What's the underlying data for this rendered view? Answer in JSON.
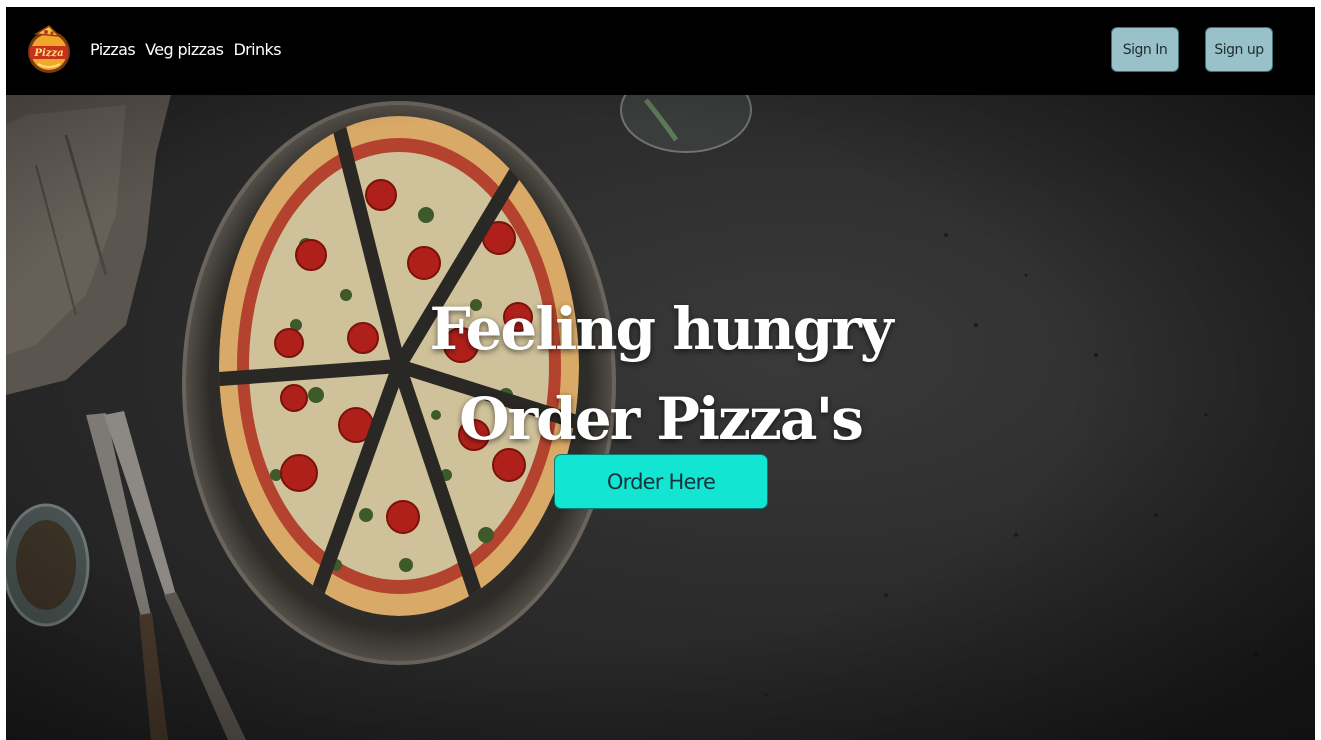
{
  "navbar": {
    "logo_icon": "pizza-logo-icon",
    "links": [
      "Pizzas",
      "Veg pizzas",
      "Drinks"
    ],
    "sign_in_label": "Sign In",
    "sign_up_label": "Sign up"
  },
  "hero": {
    "title_line1": "Feeling hungry",
    "title_line2": "Order Pizza's",
    "order_button_label": "Order Here",
    "background_image": "pizza-on-stone-table-photo"
  },
  "colors": {
    "navbar_bg": "#000000",
    "auth_button_bg": "#98c1c9",
    "order_button_bg": "#13e5d3",
    "hero_text": "#ffffff"
  }
}
